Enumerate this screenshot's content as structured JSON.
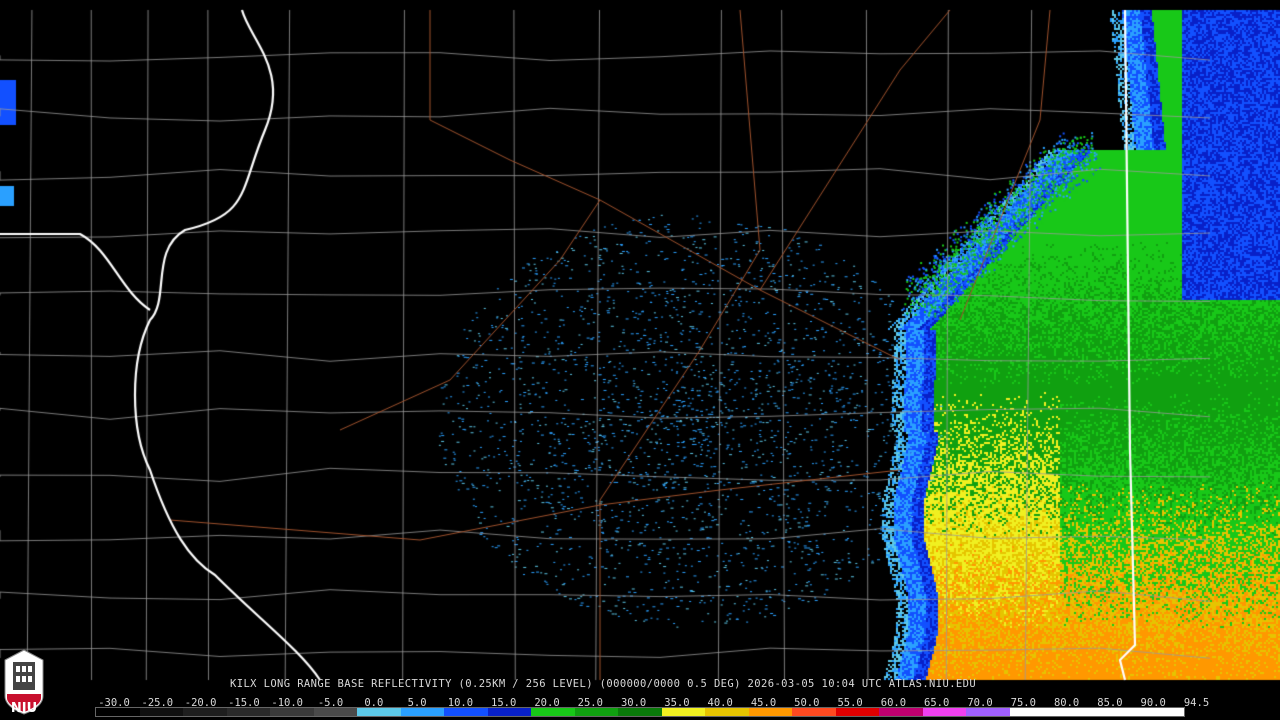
{
  "caption": "KILX LONG RANGE BASE REFLECTIVITY (0.25KM / 256 LEVEL) (000000/0000 0.5 DEG) 2026-03-05 10:04 UTC  ATLAS.NIU.EDU",
  "scale": {
    "labels": [
      "-30.0",
      "-25.0",
      "-20.0",
      "-15.0",
      "-10.0",
      "-5.0",
      "0.0",
      "5.0",
      "10.0",
      "15.0",
      "20.0",
      "25.0",
      "30.0",
      "35.0",
      "40.0",
      "45.0",
      "50.0",
      "55.0",
      "60.0",
      "65.0",
      "70.0",
      "75.0",
      "80.0",
      "85.0",
      "90.0",
      "94.5"
    ],
    "colors": [
      "#000000",
      "#101010",
      "#1e1e1e",
      "#2a2a2a",
      "#3a3a3a",
      "#4a4a4a",
      "#5cc8e8",
      "#2aa0ff",
      "#1250ff",
      "#0820c8",
      "#18c818",
      "#10a010",
      "#0a7a0a",
      "#f0f020",
      "#e6c400",
      "#ff9800",
      "#ff4a20",
      "#e00000",
      "#c00070",
      "#f040f0",
      "#a060ff",
      "#ffffff",
      "#ffffff",
      "#ffffff",
      "#ffffff"
    ]
  },
  "logo": {
    "text": "NIU",
    "color": "#c8102e"
  }
}
